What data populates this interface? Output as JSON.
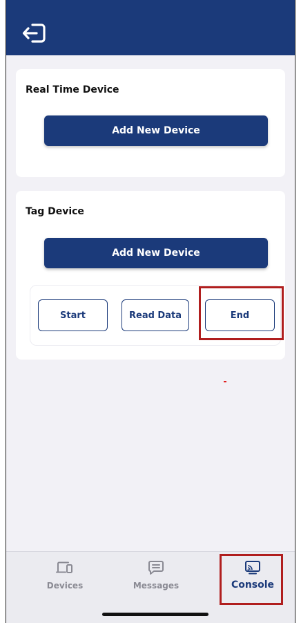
{
  "header": {
    "logout_icon": "logout-icon"
  },
  "real_time_section": {
    "title": "Real Time Device",
    "add_button_label": "Add New Device"
  },
  "tag_section": {
    "title": "Tag Device",
    "add_button_label": "Add New Device",
    "actions": {
      "start_label": "Start",
      "read_label": "Read Data",
      "end_label": "End"
    }
  },
  "tabbar": {
    "tabs": [
      {
        "label": "Devices",
        "icon": "devices-icon",
        "active": false
      },
      {
        "label": "Messages",
        "icon": "messages-icon",
        "active": false
      },
      {
        "label": "Console",
        "icon": "console-icon",
        "active": true
      }
    ]
  },
  "colors": {
    "primary": "#1b3a7a",
    "highlight": "#b01e1e",
    "inactive_tab": "#8a8a93",
    "background": "#f2f1f6"
  }
}
